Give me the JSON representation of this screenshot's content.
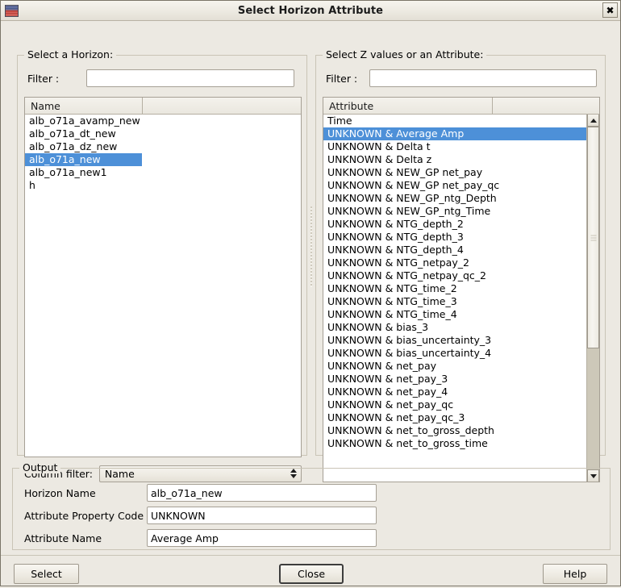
{
  "window": {
    "title": "Select Horizon Attribute",
    "icon": "horizon-layers-icon",
    "close_icon": "close-icon",
    "accent_selection_color": "#4d90d8",
    "background_color": "#ece9e2"
  },
  "left_panel": {
    "legend": "Select a Horizon:",
    "filter": {
      "label": "Filter :",
      "value": "",
      "placeholder": ""
    },
    "table": {
      "columns": [
        "Name"
      ],
      "rows": [
        "alb_o71a_avamp_new",
        "alb_o71a_dt_new",
        "alb_o71a_dz_new",
        "alb_o71a_new",
        "alb_o71a_new1",
        "h"
      ],
      "selected_index": 3
    },
    "column_filter": {
      "label": "Column filter:",
      "value": "Name",
      "options": [
        "Name"
      ]
    }
  },
  "right_panel": {
    "legend": "Select Z values or an Attribute:",
    "filter": {
      "label": "Filter :",
      "value": "",
      "placeholder": ""
    },
    "table": {
      "columns": [
        "Attribute"
      ],
      "rows": [
        "Time",
        "UNKNOWN & Average Amp",
        "UNKNOWN & Delta t",
        "UNKNOWN & Delta z",
        "UNKNOWN & NEW_GP net_pay",
        "UNKNOWN & NEW_GP net_pay_qc",
        "UNKNOWN & NEW_GP_ntg_Depth",
        "UNKNOWN & NEW_GP_ntg_Time",
        "UNKNOWN & NTG_depth_2",
        "UNKNOWN & NTG_depth_3",
        "UNKNOWN & NTG_depth_4",
        "UNKNOWN & NTG_netpay_2",
        "UNKNOWN & NTG_netpay_qc_2",
        "UNKNOWN & NTG_time_2",
        "UNKNOWN & NTG_time_3",
        "UNKNOWN & NTG_time_4",
        "UNKNOWN & bias_3",
        "UNKNOWN & bias_uncertainty_3",
        "UNKNOWN & bias_uncertainty_4",
        "UNKNOWN & net_pay",
        "UNKNOWN & net_pay_3",
        "UNKNOWN & net_pay_4",
        "UNKNOWN & net_pay_qc",
        "UNKNOWN & net_pay_qc_3",
        "UNKNOWN & net_to_gross_depth",
        "UNKNOWN & net_to_gross_time"
      ],
      "selected_index": 1
    },
    "scrollbar": {
      "up_icon": "arrow-up-icon",
      "down_icon": "arrow-down-icon",
      "thumb_grip_icon": "grip-icon"
    }
  },
  "output": {
    "legend": "Output",
    "fields": [
      {
        "label": "Horizon Name",
        "value": "alb_o71a_new"
      },
      {
        "label": "Attribute Property Code",
        "value": "UNKNOWN"
      },
      {
        "label": "Attribute Name",
        "value": "Average Amp"
      }
    ]
  },
  "buttons": {
    "select": "Select",
    "close": "Close",
    "help": "Help"
  }
}
